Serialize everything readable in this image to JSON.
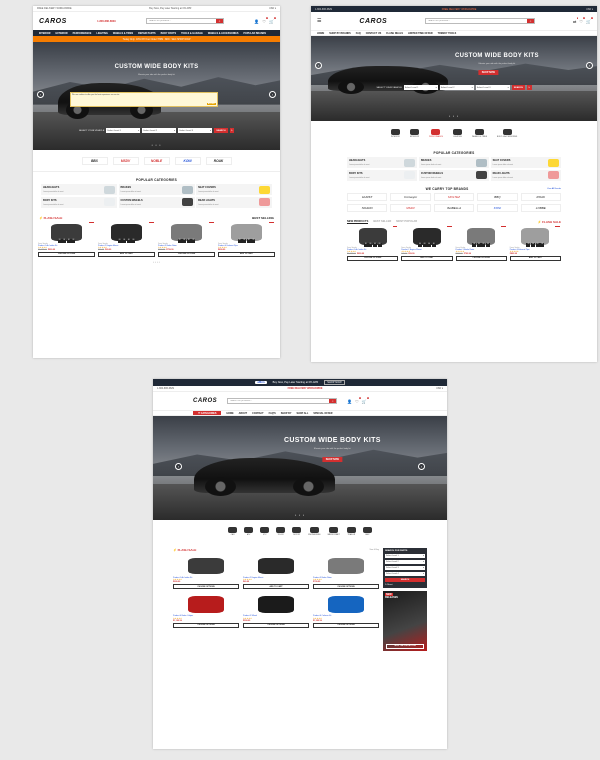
{
  "promo": {
    "text": "Buy Now, Pay Later Starting at 0% APR",
    "pay": "affirm",
    "shop": "SHOP NOW"
  },
  "phone": "1-800-686-6829",
  "logo": "CAROS",
  "search_placeholder": "Search for products...",
  "nav": [
    "INTERIOR",
    "EXTERIOR",
    "PERFORMANCE",
    "LIGHTING",
    "WHEELS & TIRES",
    "REPAIR PARTS",
    "BODY PARTS",
    "TOOLS & GARAGE",
    "WHEELS & ACCESSORIES",
    "POPULAR BRANDS"
  ],
  "nav_light": [
    "HOME",
    "SHOP BY BRANDS",
    "FAQ",
    "CONTACT US",
    "FLASH DEALS",
    "LIMITED TIME OFFER",
    "TRENDY TOOLS"
  ],
  "nav3": [
    "HOME",
    "ABOUT",
    "CONTACT",
    "FAQ'S",
    "SHOP BY",
    "SHOP ALL",
    "SPECIAL OFFER"
  ],
  "orange_bar": "Today Only: 10% Off Your Order!  HRS : MIN : SEC  SHOP NOW",
  "free_shipping": "FREE DELIVERY WORLDWIDE",
  "hero": {
    "title": "CUSTOM WIDE BODY KITS",
    "subtitle": "Elevate your ride with the perfect body kit",
    "cta": "SHOP NOW",
    "dots": "• • •"
  },
  "popup": "We use cookies to offer you the best experience on our site.",
  "popup_btn": "ACCEPT",
  "finder": {
    "label": "SELECT YOUR VEHICLE",
    "selects": [
      "Select Level 1",
      "Select Level 2",
      "Select Level 3"
    ],
    "go": "SEARCH"
  },
  "brands": [
    "BBX",
    "MSDV",
    "NOBLE",
    "KONI",
    "ROAK"
  ],
  "brands2": [
    "HURST",
    "Conveyor",
    "MOLTEZ",
    "BBQ",
    "ROAK",
    "NOADO",
    "MSDV",
    "ISABELLA",
    "KONI",
    "LOBBE"
  ],
  "brands_title": "WE CARRY TOP BRANDS",
  "view_all": "View All Brands",
  "categories_title": "POPULAR CATEGORIES",
  "categories": [
    {
      "name": "HEADLIGHTS",
      "sub": "Lorem ipsum dolor sit amet"
    },
    {
      "name": "BRAKES",
      "sub": "Lorem ipsum dolor sit amet"
    },
    {
      "name": "SEAT COVERS",
      "sub": "Lorem ipsum dolor sit amet"
    },
    {
      "name": "BODY KITS",
      "sub": "Lorem ipsum dolor sit amet"
    },
    {
      "name": "CUSTOM WHEELS",
      "sub": "Lorem ipsum dolor sit amet"
    },
    {
      "name": "REAR LIGHTS",
      "sub": "Lorem ipsum dolor sit amet"
    }
  ],
  "flash_sale": "FLASH SALE",
  "best_selling": "BEST SELLING",
  "product_tabs": [
    "NEW PRODUCTS",
    "BEST SELLER",
    "MOST POPULAR"
  ],
  "products": [
    {
      "vendor": "Demo Vendor",
      "name": "Product 1 Air Intake Kit",
      "old": "$1,387.99",
      "price": "$999.99",
      "button": "CHOOSE OPTIONS",
      "badge": "-28%",
      "color": "#3b3b3b"
    },
    {
      "vendor": "Demo Vendor",
      "name": "Product 2 Engine Mount",
      "old": "$79.99",
      "price": "$69.99",
      "button": "ADD TO CART",
      "badge": "-13%",
      "color": "#2a2a2a"
    },
    {
      "vendor": "Demo Vendor",
      "name": "Product 3 Brake Rotor",
      "old": "$999.99",
      "price": "$799.99",
      "button": "CHOOSE OPTIONS",
      "badge": "-20%",
      "color": "#7a7a7a"
    },
    {
      "vendor": "Demo Vendor",
      "name": "Product 4 Exhaust Pipe",
      "old": "",
      "price": "$899.99",
      "button": "ADD TO CART",
      "badge": "-10%",
      "color": "#9e9e9e"
    }
  ],
  "products3": [
    {
      "name": "Product 1 Air Intake Kit",
      "price": "$999.99",
      "button": "CHOOSE OPTIONS",
      "color": "#3b3b3b"
    },
    {
      "name": "Product 2 Engine Mount",
      "price": "$69.99",
      "button": "ADD TO CART",
      "color": "#2a2a2a"
    },
    {
      "name": "Product 3 Brake Rotor",
      "price": "$799.99",
      "button": "CHOOSE OPTIONS",
      "color": "#7a7a7a"
    },
    {
      "name": "Product 4 Brake Caliper",
      "price": "$1,199.99",
      "button": "CHOOSE OPTIONS",
      "color": "#b71c1c"
    },
    {
      "name": "Product 5 Wheel",
      "price": "$599.99",
      "button": "CHOOSE OPTIONS",
      "color": "#1b1b1b"
    },
    {
      "name": "Product 6 Coilover Kit",
      "price": "$1,299.99",
      "button": "CHOOSE OPTIONS",
      "color": "#1565c0"
    }
  ],
  "icon_cats": [
    "INTERIOR",
    "EXTERIOR",
    "PERFORMANCE",
    "LIGHTING",
    "WHEELS & TIRES",
    "BODY & ACCESSORIES"
  ],
  "icon_cats3": [
    "CAR",
    "ATV",
    "UTV",
    "TRUCK",
    "MOTOR",
    "SNOWMOBILE",
    "WATERCRAFT",
    "TRAILER",
    "JEEP"
  ],
  "sidebar": {
    "title": "SEARCH FOR PARTS",
    "selects": [
      "Select Level 1",
      "Select Level 2",
      "Select Level 3",
      "Select Level 4"
    ],
    "go": "SEARCH",
    "reset": "Reset"
  },
  "release": {
    "new": "NEW",
    "title": "RELEASES",
    "button": "SHOP THE COLLECTION"
  },
  "see_all": "See & Buy"
}
